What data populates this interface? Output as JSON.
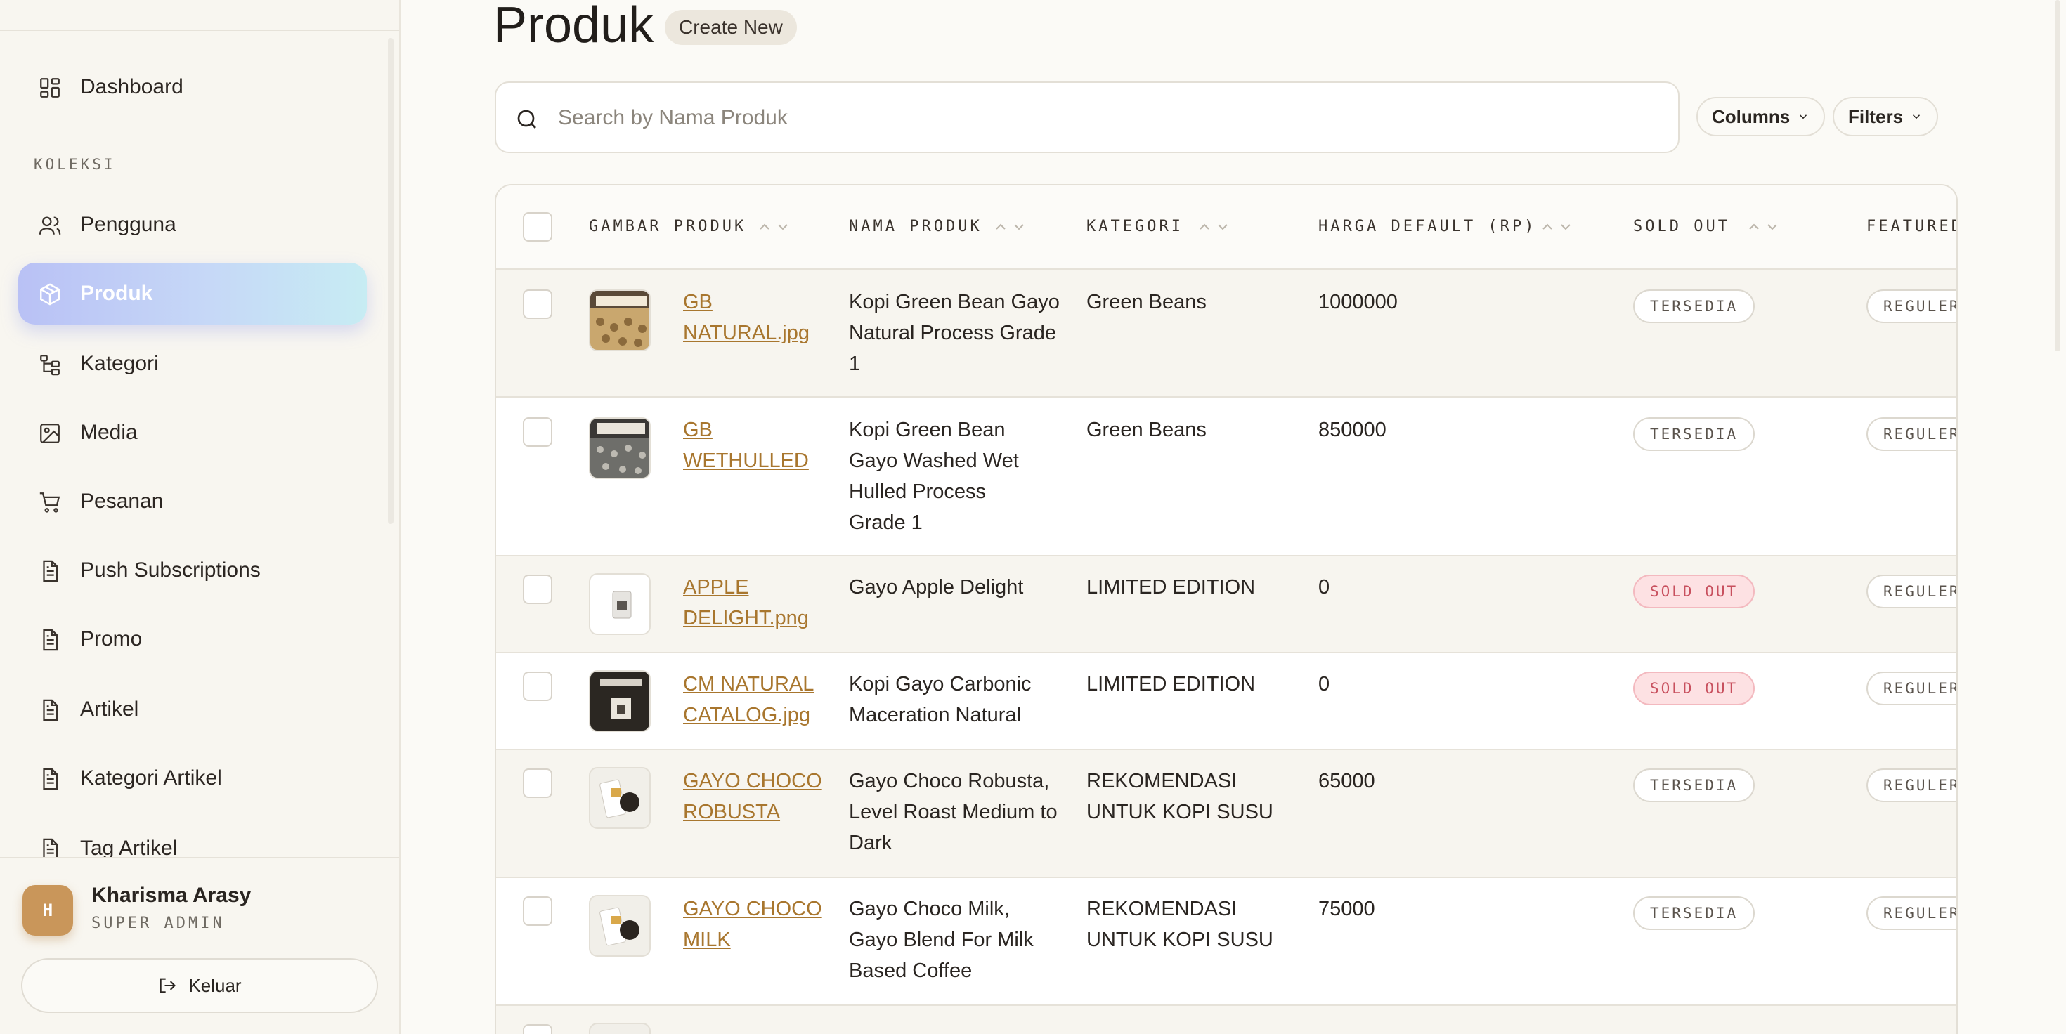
{
  "sidebar": {
    "section_label": "KOLEKSI",
    "items": [
      {
        "label": "Dashboard",
        "icon": "dashboard-icon"
      },
      {
        "label": "Pengguna",
        "icon": "users-icon"
      },
      {
        "label": "Produk",
        "icon": "box-icon",
        "active": true
      },
      {
        "label": "Kategori",
        "icon": "tree-icon"
      },
      {
        "label": "Media",
        "icon": "image-icon"
      },
      {
        "label": "Pesanan",
        "icon": "cart-icon"
      },
      {
        "label": "Push Subscriptions",
        "icon": "document-icon"
      },
      {
        "label": "Promo",
        "icon": "document-icon"
      },
      {
        "label": "Artikel",
        "icon": "document-icon"
      },
      {
        "label": "Kategori Artikel",
        "icon": "document-icon"
      },
      {
        "label": "Tag Artikel",
        "icon": "document-icon"
      }
    ],
    "user": {
      "initial": "H",
      "name": "Kharisma Arasy",
      "role": "SUPER ADMIN"
    },
    "logout_label": "Keluar"
  },
  "main": {
    "title": "Produk",
    "create_label": "Create New",
    "search": {
      "placeholder": "Search by Nama Produk",
      "value": ""
    },
    "columns_label": "Columns",
    "filters_label": "Filters"
  },
  "table": {
    "headers": [
      "GAMBAR PRODUK",
      "NAMA PRODUK",
      "KATEGORI",
      "HARGA DEFAULT (RP)",
      "SOLD OUT",
      "FEATURED"
    ],
    "rows": [
      {
        "file": "GB NATURAL.jpg",
        "name": "Kopi Green Bean Gayo Natural Process Grade 1",
        "category": "Green Beans",
        "price": "1000000",
        "sold_out": "TERSEDIA",
        "featured": "REGULER"
      },
      {
        "file": "GB WETHULLED",
        "name": "Kopi Green Bean Gayo Washed Wet Hulled Process Grade 1",
        "category": "Green Beans",
        "price": "850000",
        "sold_out": "TERSEDIA",
        "featured": "REGULER"
      },
      {
        "file": "APPLE DELIGHT.png",
        "name": "Gayo Apple Delight",
        "category": "LIMITED EDITION",
        "price": "0",
        "sold_out": "SOLD OUT",
        "featured": "REGULER"
      },
      {
        "file": "CM NATURAL CATALOG.jpg",
        "name": "Kopi Gayo Carbonic Maceration Natural",
        "category": "LIMITED EDITION",
        "price": "0",
        "sold_out": "SOLD OUT",
        "featured": "REGULER"
      },
      {
        "file": "GAYO CHOCO ROBUSTA",
        "name": "Gayo Choco Robusta, Level Roast Medium to Dark",
        "category": "REKOMENDASI UNTUK KOPI SUSU",
        "price": "65000",
        "sold_out": "TERSEDIA",
        "featured": "REGULER"
      },
      {
        "file": "GAYO CHOCO MILK",
        "name": "Gayo Choco Milk, Gayo Blend For Milk Based Coffee",
        "category": "REKOMENDASI UNTUK KOPI SUSU",
        "price": "75000",
        "sold_out": "TERSEDIA",
        "featured": "REGULER"
      }
    ]
  },
  "colors": {
    "accent_link": "#a8762e",
    "active_nav_start": "#b9c1f5",
    "active_nav_end": "#c7ecf3",
    "sold_out_bg": "#fde1e3",
    "sold_out_text": "#c8505e"
  }
}
